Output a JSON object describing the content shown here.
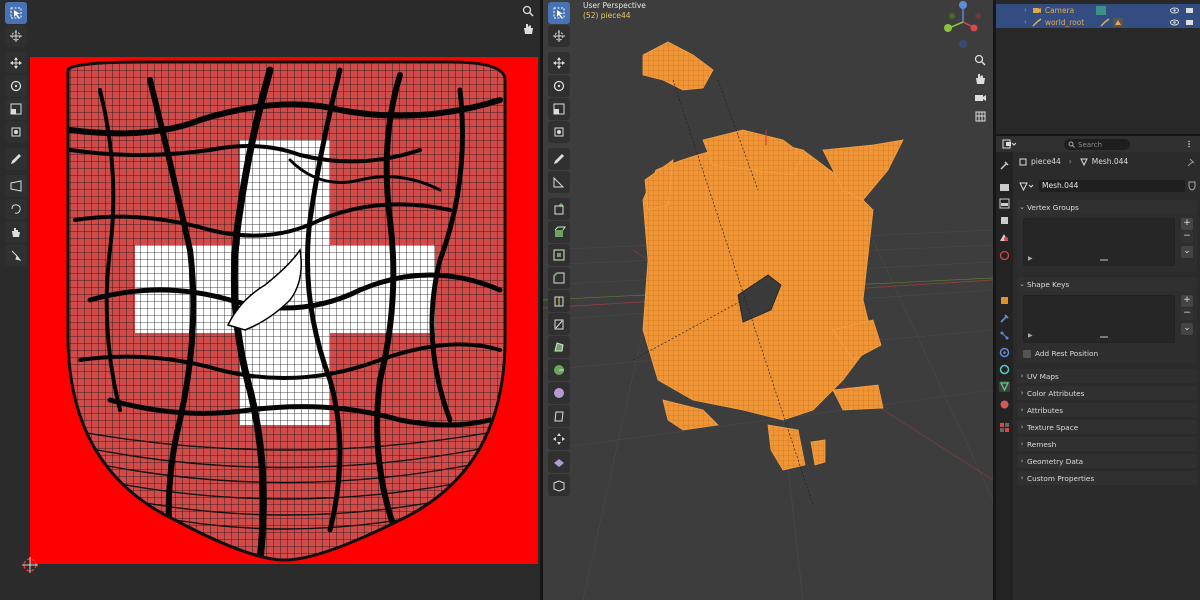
{
  "viewport": {
    "title": "User Perspective",
    "subtitle": "(52) piece44"
  },
  "outliner": {
    "rows": [
      {
        "label": "Camera"
      },
      {
        "label": "world_root"
      }
    ]
  },
  "properties": {
    "search_placeholder": "Search",
    "breadcrumb": {
      "object": "piece44",
      "mesh": "Mesh.044"
    },
    "mesh_name": "Mesh.044",
    "sections": {
      "vertex_groups": "Vertex Groups",
      "shape_keys": "Shape Keys",
      "add_rest_position": "Add Rest Position",
      "uv_maps": "UV Maps",
      "color_attributes": "Color Attributes",
      "attributes": "Attributes",
      "texture_space": "Texture Space",
      "remesh": "Remesh",
      "geometry_data": "Geometry Data",
      "custom_properties": "Custom Properties"
    }
  },
  "colors": {
    "uv_background": "#ff0000",
    "selection_orange": "#f59a2a",
    "active_blue": "#4772b3",
    "label_orange": "#e2a850"
  }
}
